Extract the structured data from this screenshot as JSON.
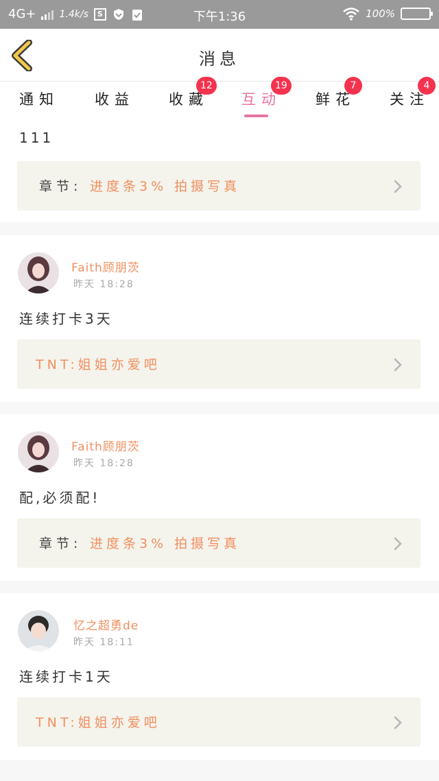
{
  "status_bar": {
    "network": "4G+",
    "speed": "1.4k/s",
    "sim_label": "S",
    "time": "下午1:36",
    "battery": "100%"
  },
  "header": {
    "title": "消息"
  },
  "tabs": [
    {
      "label": "通知",
      "badge": ""
    },
    {
      "label": "收益",
      "badge": ""
    },
    {
      "label": "收藏",
      "badge": "12"
    },
    {
      "label": "互动",
      "badge": "19",
      "active": true
    },
    {
      "label": "鲜花",
      "badge": "7"
    },
    {
      "label": "关注",
      "badge": "4"
    }
  ],
  "colors": {
    "accent": "#e774a3",
    "link": "#f09060",
    "badge": "#f5334f",
    "link_box": "#f4f3ec"
  },
  "items": [
    {
      "text": "111",
      "link_label": "章节:",
      "link_value": "进度条3% 拍摄写真"
    },
    {
      "user": "Faith顾朋茨",
      "time": "昨天 18:28",
      "text": "连续打卡3天",
      "link_label": "",
      "link_value": "TNT:姐姐亦爱吧"
    },
    {
      "user": "Faith顾朋茨",
      "time": "昨天 18:28",
      "text": "配,必须配!",
      "link_label": "章节:",
      "link_value": "进度条3% 拍摄写真"
    },
    {
      "user": "忆之超勇de",
      "time": "昨天 18:11",
      "text": "连续打卡1天",
      "link_label": "",
      "link_value": "TNT:姐姐亦爱吧"
    }
  ]
}
